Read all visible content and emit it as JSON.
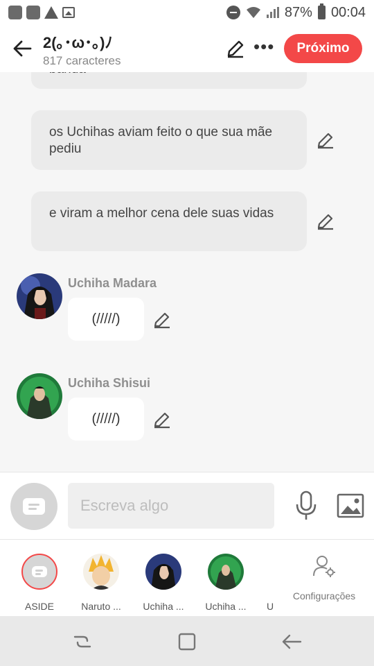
{
  "status_bar": {
    "battery": "87%",
    "time": "00:04"
  },
  "header": {
    "title": "2(｡･ω･｡)ﾉ",
    "subtitle": "817 caracteres",
    "next_label": "Próximo"
  },
  "chat": {
    "partial_text": "banda",
    "messages": [
      {
        "text": "os Uchihas aviam feito o que sua mãe pediu"
      },
      {
        "text": "e viram a melhor cena dele suas vidas"
      }
    ],
    "character_messages": [
      {
        "name": "Uchiha Madara",
        "text": "(/////)"
      },
      {
        "name": "Uchiha Shisui",
        "text": "(/////)"
      }
    ]
  },
  "input": {
    "placeholder": "Escreva algo"
  },
  "characters": [
    {
      "label": "ASIDE"
    },
    {
      "label": "Naruto ..."
    },
    {
      "label": "Uchiha ..."
    },
    {
      "label": "Uchiha ..."
    },
    {
      "label": "U"
    }
  ],
  "settings_label": "Configurações",
  "colors": {
    "accent": "#f34848",
    "bubble_gray": "#ebebeb",
    "background": "#f6f6f6"
  }
}
